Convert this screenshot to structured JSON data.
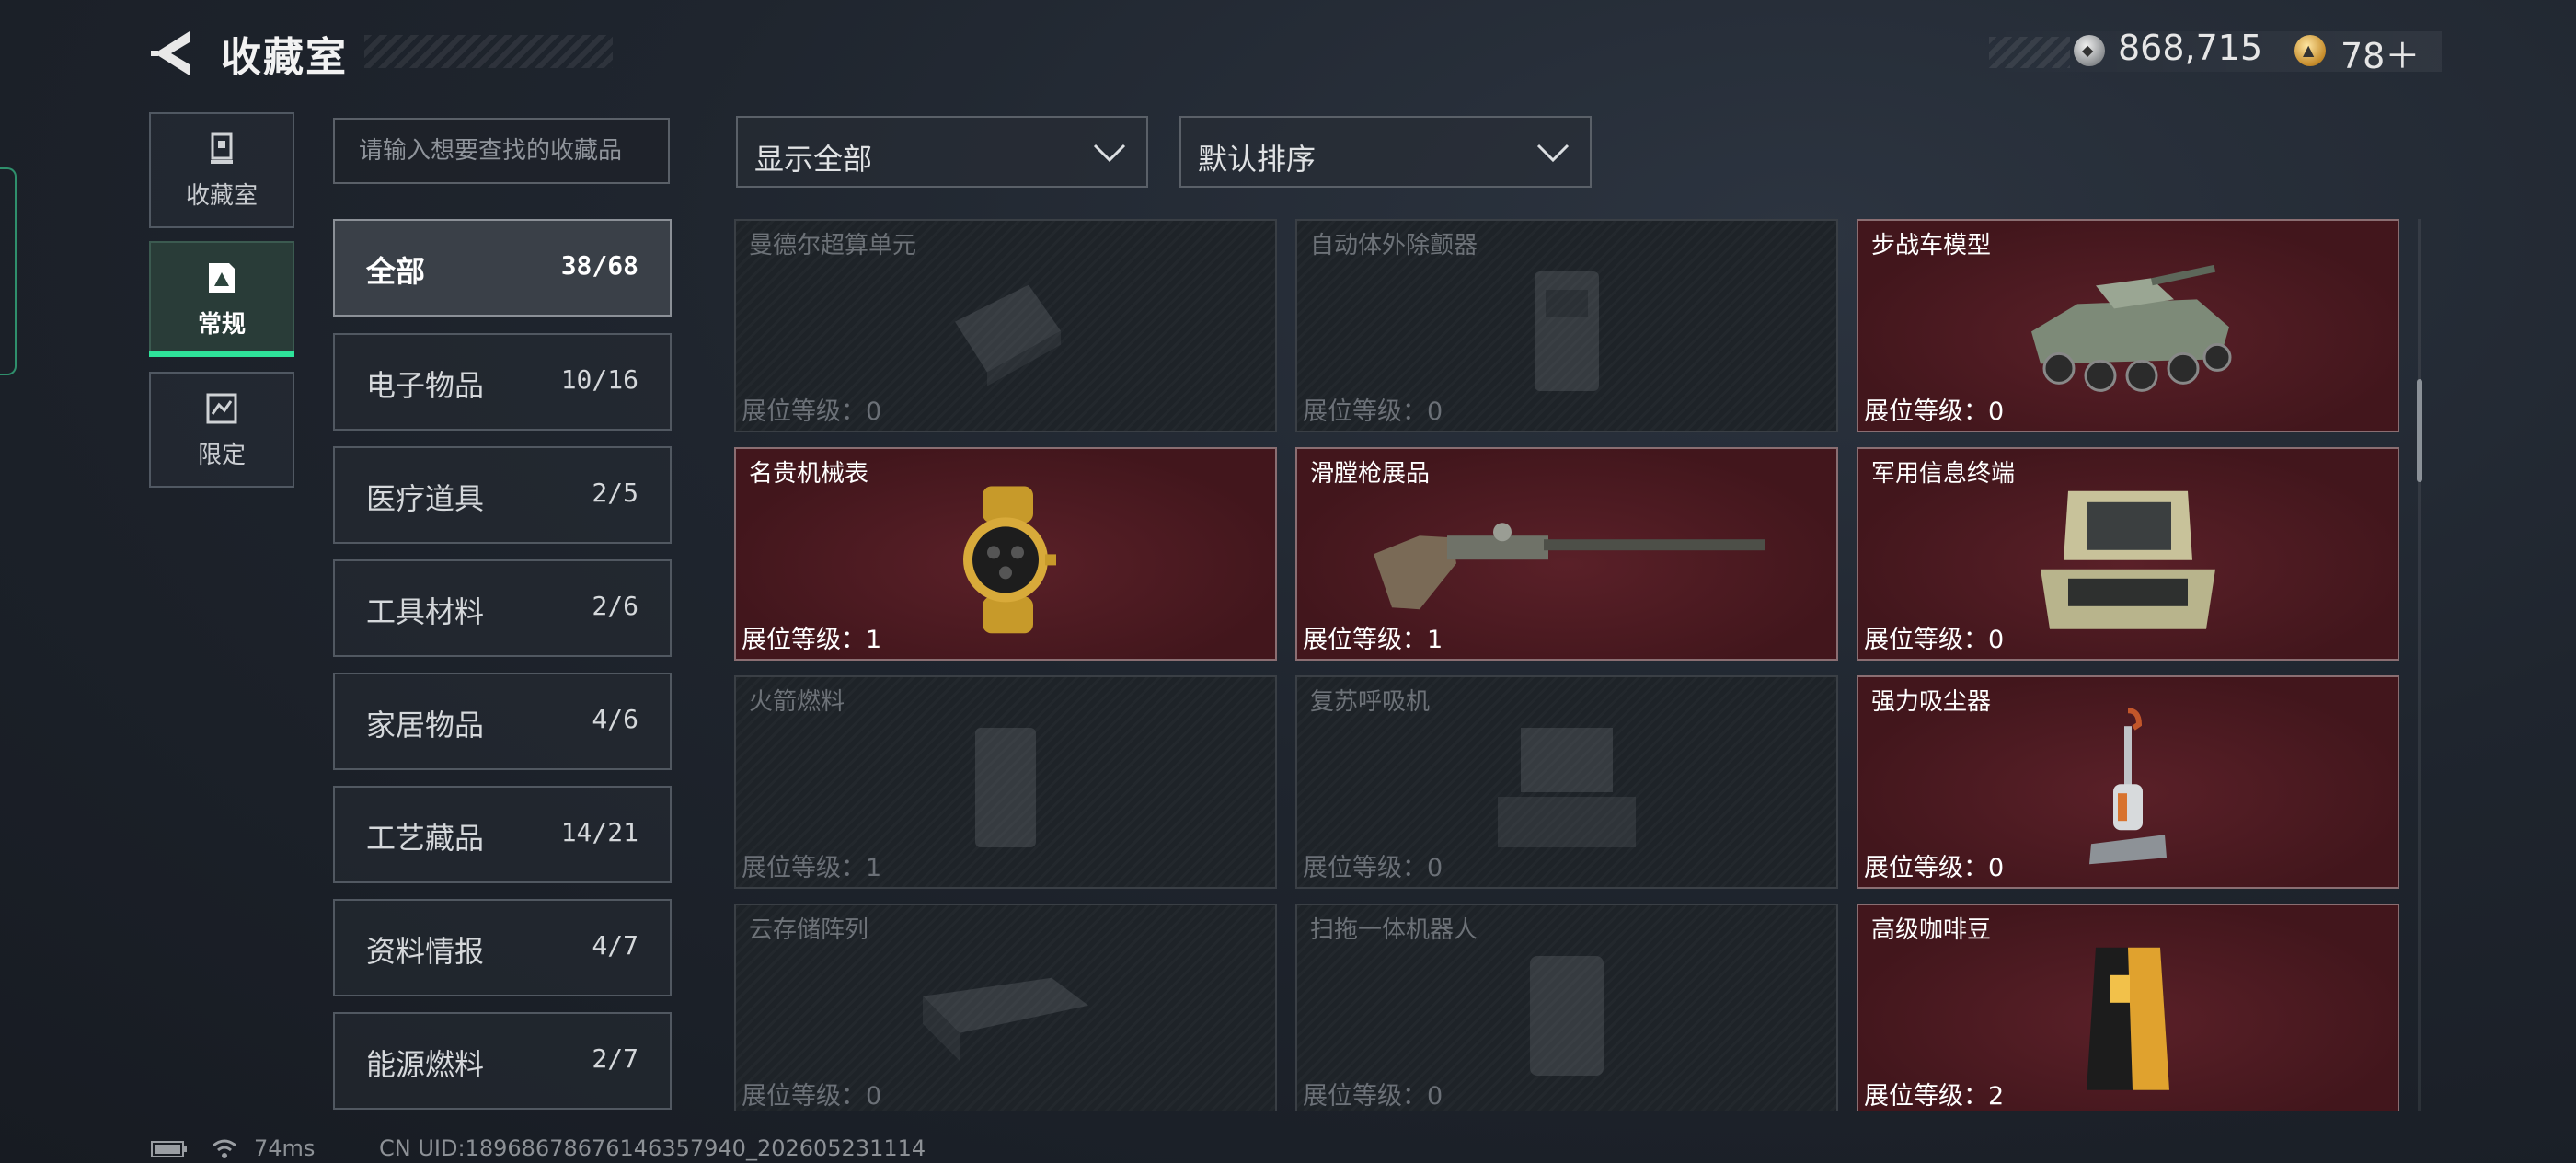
{
  "header": {
    "title": "收藏室"
  },
  "currency": {
    "silver_amount": "868,715",
    "gold_amount": "78＋"
  },
  "nav": [
    {
      "label": "收藏室",
      "icon": "trophy-icon"
    },
    {
      "label": "常规",
      "icon": "regular-icon",
      "active": true
    },
    {
      "label": "限定",
      "icon": "limited-icon"
    }
  ],
  "search": {
    "placeholder": "请输入想要查找的收藏品"
  },
  "categories": [
    {
      "name": "全部",
      "count": "38/68",
      "active": true
    },
    {
      "name": "电子物品",
      "count": "10/16"
    },
    {
      "name": "医疗道具",
      "count": "2/5"
    },
    {
      "name": "工具材料",
      "count": "2/6"
    },
    {
      "name": "家居物品",
      "count": "4/6"
    },
    {
      "name": "工艺藏品",
      "count": "14/21"
    },
    {
      "name": "资料情报",
      "count": "4/7"
    },
    {
      "name": "能源燃料",
      "count": "2/7"
    }
  ],
  "filters": {
    "display": "显示全部",
    "sort": "默认排序"
  },
  "items": [
    {
      "name": "曼德尔超算单元",
      "level": "展位等级：0",
      "unlocked": false,
      "icon": "supercomputer-icon"
    },
    {
      "name": "自动体外除颤器",
      "level": "展位等级：0",
      "unlocked": false,
      "icon": "defibrillator-icon"
    },
    {
      "name": "步战车模型",
      "level": "展位等级：0",
      "unlocked": true,
      "icon": "ifv-model-icon"
    },
    {
      "name": "名贵机械表",
      "level": "展位等级：1",
      "unlocked": true,
      "icon": "watch-icon"
    },
    {
      "name": "滑膛枪展品",
      "level": "展位等级：1",
      "unlocked": true,
      "icon": "musket-icon"
    },
    {
      "name": "军用信息终端",
      "level": "展位等级：0",
      "unlocked": true,
      "icon": "terminal-case-icon"
    },
    {
      "name": "火箭燃料",
      "level": "展位等级：1",
      "unlocked": false,
      "icon": "rocket-fuel-icon"
    },
    {
      "name": "复苏呼吸机",
      "level": "展位等级：0",
      "unlocked": false,
      "icon": "ventilator-icon"
    },
    {
      "name": "强力吸尘器",
      "level": "展位等级：0",
      "unlocked": true,
      "icon": "vacuum-icon"
    },
    {
      "name": "云存储阵列",
      "level": "展位等级：0",
      "unlocked": false,
      "icon": "storage-array-icon"
    },
    {
      "name": "扫拖一体机器人",
      "level": "展位等级：0",
      "unlocked": false,
      "icon": "robot-mop-icon"
    },
    {
      "name": "高级咖啡豆",
      "level": "展位等级：2",
      "unlocked": true,
      "icon": "coffee-bag-icon"
    }
  ],
  "footer": {
    "latency": "74ms",
    "uid": "CN UID:18968678676146357940_202605231114"
  },
  "colors": {
    "accent_green": "#2ee39a",
    "unlocked_card": "#4a1a20",
    "locked_card": "#1e2328"
  }
}
